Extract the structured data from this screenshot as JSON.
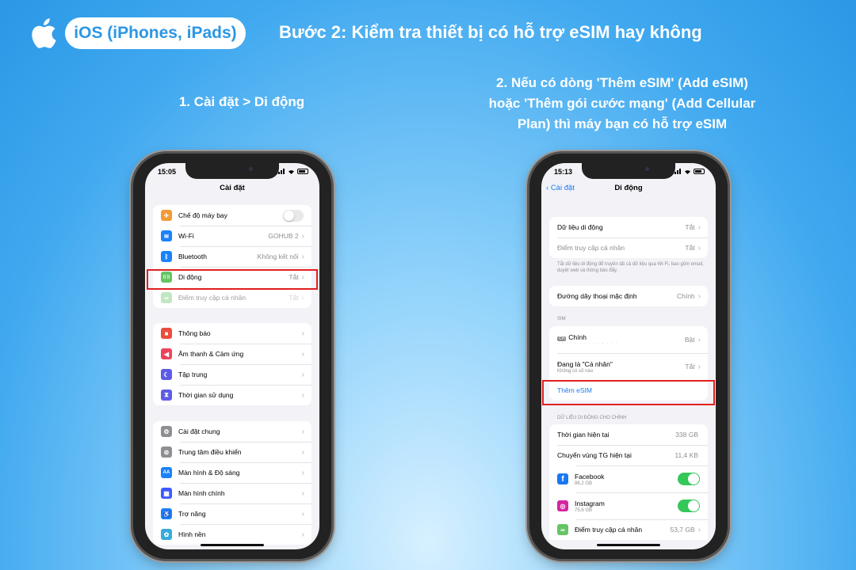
{
  "header": {
    "platform_label": "iOS (iPhones, iPads)",
    "step_title": "Bước 2: Kiểm tra thiết bị có hỗ trợ eSIM hay không"
  },
  "captions": {
    "step1": "1. Cài đặt > Di động",
    "step2_line1": "2. Nếu có dòng 'Thêm eSIM' (Add eSIM)",
    "step2_line2": "hoặc 'Thêm gói cước mạng' (Add Cellular",
    "step2_line3": "Plan) thì máy bạn có hỗ trợ eSIM"
  },
  "phone1": {
    "time": "15:05",
    "title": "Cài đặt",
    "group1": [
      {
        "label": "Chế độ máy bay",
        "value": "",
        "icon": "airplane-icon",
        "color": "#f19a37",
        "glyph": "✈"
      },
      {
        "label": "Wi-Fi",
        "value": "GOHUB 2",
        "icon": "wifi-icon",
        "color": "#1a82fb",
        "glyph": "≋"
      },
      {
        "label": "Bluetooth",
        "value": "Không kết nối",
        "icon": "bluetooth-icon",
        "color": "#1a82fb",
        "glyph": "ᛒ"
      },
      {
        "label": "Di động",
        "value": "Tắt",
        "icon": "cellular-icon",
        "color": "#65c466",
        "glyph": "((·))"
      },
      {
        "label": "Điểm truy cập cá nhân",
        "value": "Tắt",
        "icon": "hotspot-icon",
        "color": "#65c466",
        "glyph": "∞"
      }
    ],
    "group2": [
      {
        "label": "Thông báo",
        "icon": "notifications-icon",
        "color": "#eb4d3d",
        "glyph": "■"
      },
      {
        "label": "Âm thanh & Cảm ứng",
        "icon": "sounds-icon",
        "color": "#eb445a",
        "glyph": "◀"
      },
      {
        "label": "Tập trung",
        "icon": "focus-icon",
        "color": "#5e5ce6",
        "glyph": "☾"
      },
      {
        "label": "Thời gian sử dụng",
        "icon": "screen-time-icon",
        "color": "#5e5ce6",
        "glyph": "⧗"
      }
    ],
    "group3": [
      {
        "label": "Cài đặt chung",
        "icon": "general-icon",
        "color": "#8e8e93",
        "glyph": "⚙"
      },
      {
        "label": "Trung tâm điều khiển",
        "icon": "control-center-icon",
        "color": "#8e8e93",
        "glyph": "⊜"
      },
      {
        "label": "Màn hình & Độ sáng",
        "icon": "display-icon",
        "color": "#1a82fb",
        "glyph": "AA"
      },
      {
        "label": "Màn hình chính",
        "icon": "home-screen-icon",
        "color": "#3d5afe",
        "glyph": "▦"
      },
      {
        "label": "Trợ năng",
        "icon": "accessibility-icon",
        "color": "#1a82fb",
        "glyph": "♿"
      },
      {
        "label": "Hình nền",
        "icon": "wallpaper-icon",
        "color": "#36aadc",
        "glyph": "✿"
      }
    ]
  },
  "phone2": {
    "time": "15:13",
    "back_label": "Cài đặt",
    "title": "Di động",
    "group1": [
      {
        "label": "Dữ liệu di động",
        "value": "Tắt"
      },
      {
        "label": "Điểm truy cập cá nhân",
        "value": "Tắt"
      }
    ],
    "note": "Tắt dữ liệu di động để truyền tất cả dữ liệu qua Wi-Fi, bao gồm email, duyệt web và thông báo đẩy.",
    "default_line": {
      "label": "Đường dây thoại mặc định",
      "value": "Chính"
    },
    "sim_header": "SIM",
    "sim_primary": {
      "badge": "CH",
      "label": "Chính",
      "value": "Bật",
      "masked": "· · · · · · · · · · · · · ·"
    },
    "sim_personal": {
      "label": "Đang là \"Cá nhân\"",
      "sub": "Không có số nào",
      "value": "Tắt"
    },
    "add_esim": "Thêm eSIM",
    "data_header": "DỮ LIỆU DI ĐỘNG CHO CHÍNH",
    "data_rows": [
      {
        "label": "Thời gian hiện tại",
        "value": "338 GB"
      },
      {
        "label": "Chuyển vùng TG hiện tại",
        "value": "11,4 KB"
      }
    ],
    "apps": [
      {
        "label": "Facebook",
        "sub": "86,2 GB",
        "icon": "facebook-icon",
        "color": "#1877f2",
        "glyph": "f"
      },
      {
        "label": "Instagram",
        "sub": "75,6 GB",
        "icon": "instagram-icon",
        "color": "#d6249f",
        "glyph": "◎"
      }
    ],
    "hotspot_row": {
      "label": "Điểm truy cập cá nhân",
      "value": "53,7 GB"
    }
  }
}
